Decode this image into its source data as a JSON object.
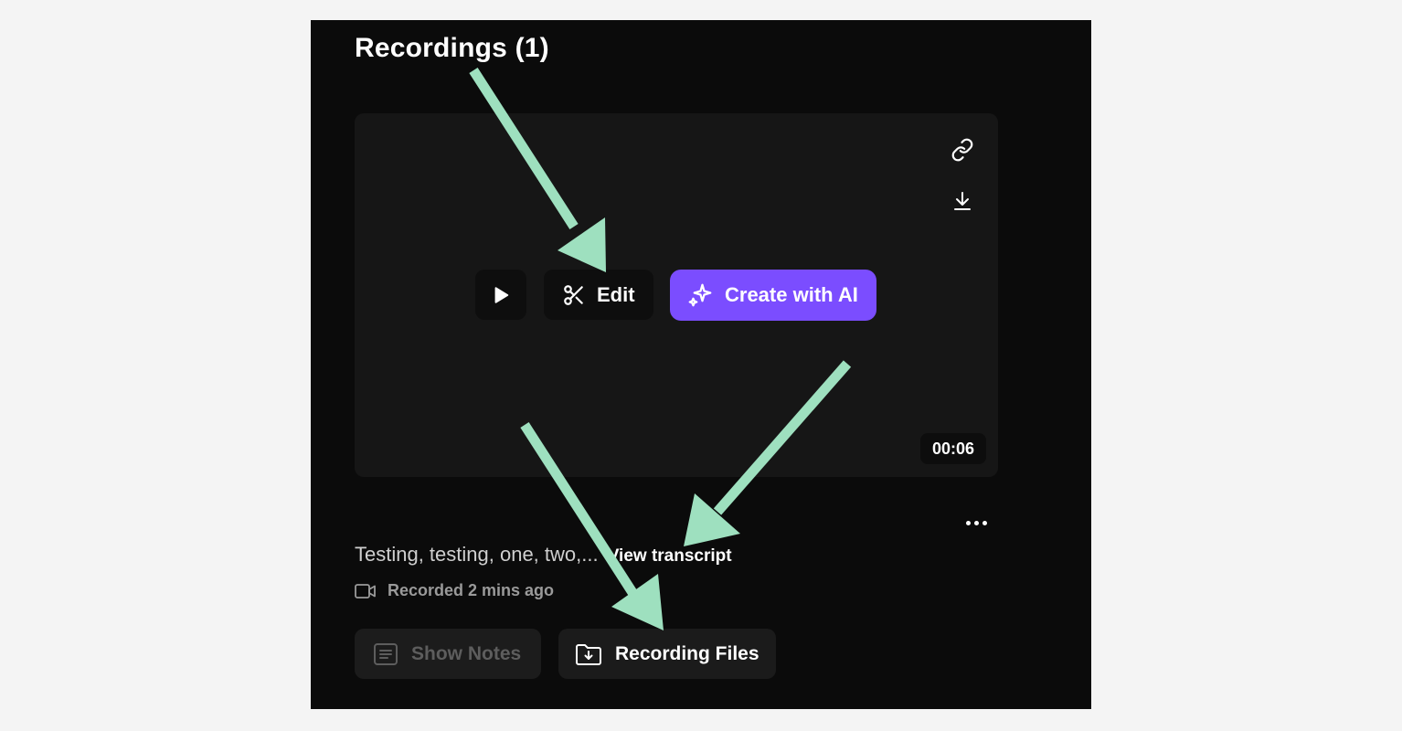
{
  "header": {
    "title": "Recordings (1)"
  },
  "player": {
    "edit_label": "Edit",
    "create_ai_label": "Create with AI",
    "duration": "00:06"
  },
  "details": {
    "transcript_preview": "Testing, testing, one, two,...",
    "view_transcript_label": "View transcript",
    "recorded_text": "Recorded 2 mins ago"
  },
  "actions": {
    "show_notes_label": "Show Notes",
    "recording_files_label": "Recording Files"
  },
  "icons": {
    "link": "link-icon",
    "download": "download-icon",
    "play": "play-icon",
    "scissors": "scissors-icon",
    "sparkle": "sparkle-icon",
    "more": "more-horizontal-icon",
    "video": "video-camera-icon",
    "notes": "notes-icon",
    "folder": "folder-download-icon"
  },
  "colors": {
    "accent": "#7b4dff",
    "panel_bg": "#0b0b0b",
    "video_bg": "#161616",
    "annotation_arrow": "#9ee0bf"
  }
}
